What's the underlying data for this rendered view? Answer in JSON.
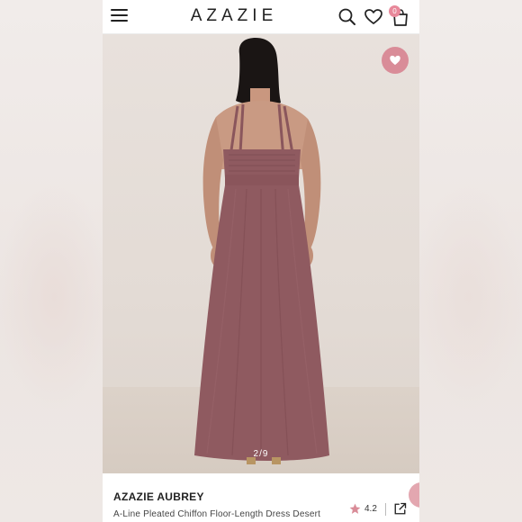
{
  "header": {
    "brand": "AZAZIE",
    "cart_count": "0",
    "icons": [
      "menu-icon",
      "search-icon",
      "heart-icon",
      "shopping-bag-icon"
    ]
  },
  "gallery": {
    "counter": "2/9",
    "current_image": 2,
    "total_images": 9,
    "wishlist_icon": "heart-icon",
    "dress_color": "#8f5a60"
  },
  "product": {
    "title": "AZAZIE AUBREY",
    "subtitle": "A-Line Pleated Chiffon Floor-Length Dress Desert",
    "rating": "4.2",
    "rating_icon": "star-icon",
    "share_icon": "share-icon"
  },
  "colors": {
    "accent": "#d98c98",
    "badge": "#e8889a",
    "text": "#222222"
  }
}
